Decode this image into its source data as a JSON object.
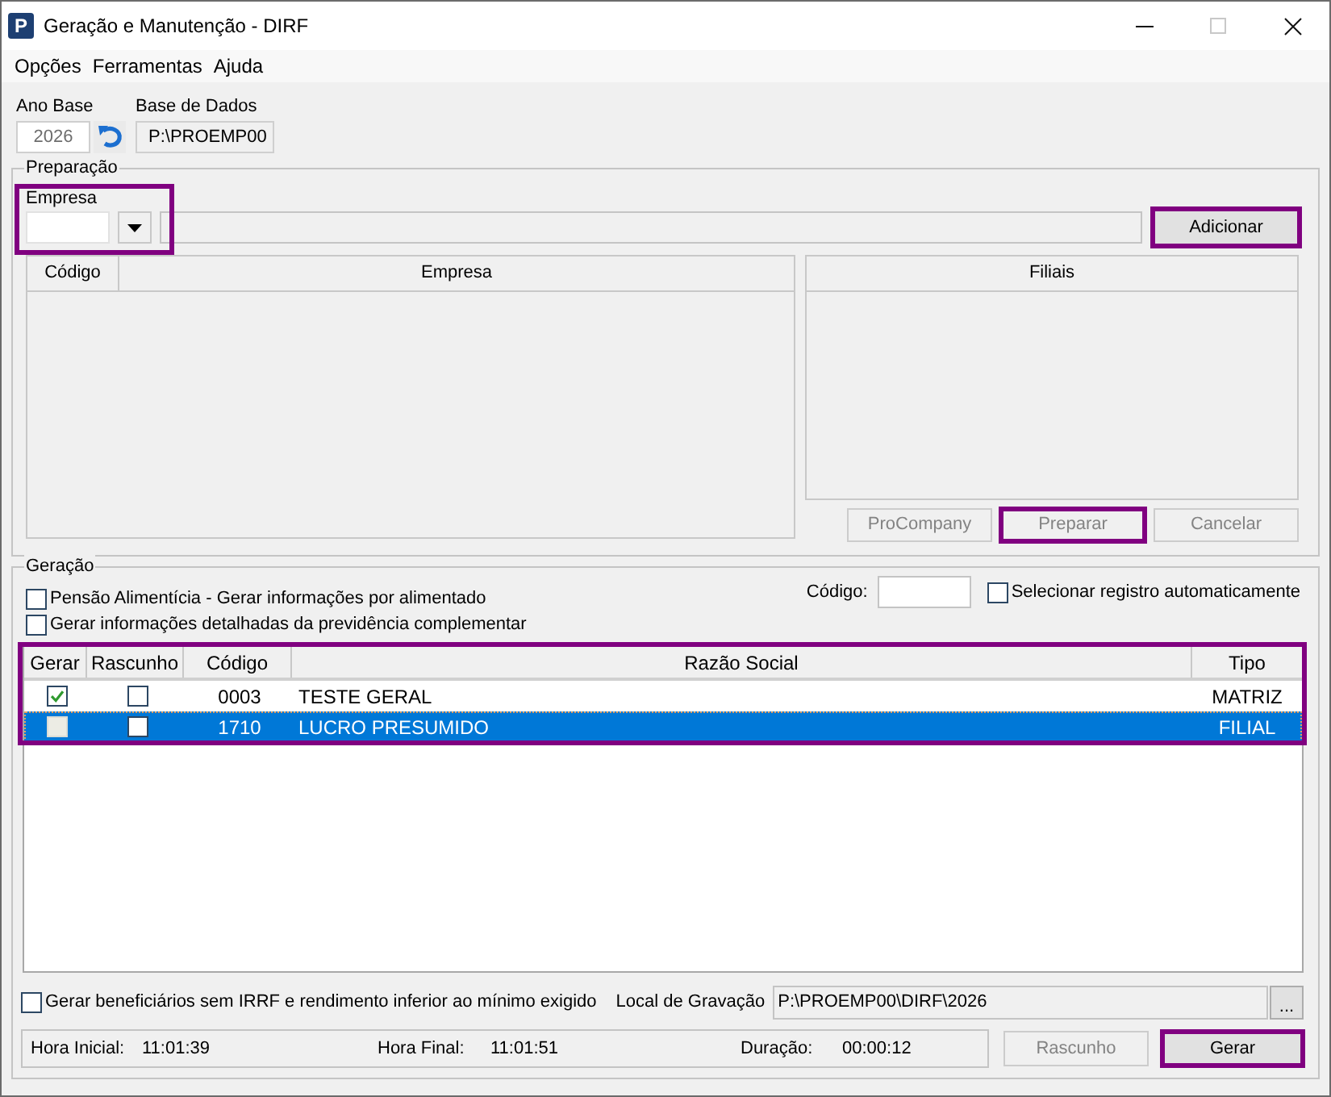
{
  "window": {
    "icon_letter": "P",
    "title": "Geração e Manutenção - DIRF",
    "controls": [
      {
        "kind": "minimize",
        "disabled": false
      },
      {
        "kind": "maximize",
        "disabled": true
      },
      {
        "kind": "close",
        "disabled": false
      }
    ]
  },
  "menu": [
    {
      "label": "Opções"
    },
    {
      "label": "Ferramentas"
    },
    {
      "label": "Ajuda"
    }
  ],
  "ano_base": {
    "label": "Ano Base",
    "value": "2026",
    "disabled": true
  },
  "base_de_dados": {
    "label": "Base de Dados",
    "value": "P:\\PROEMP00"
  },
  "preparacao": {
    "title": "Preparação",
    "empresa": {
      "label": "Empresa",
      "highlighted": true
    },
    "add_button": {
      "label": "Adicionar",
      "disabled": false,
      "highlighted": true
    },
    "empresas_table": {
      "columns": [
        "Código",
        "Empresa"
      ]
    },
    "filiais_table": {
      "columns": [
        "Filiais"
      ]
    },
    "buttons": [
      {
        "label": "ProCompany",
        "disabled": true,
        "highlighted": false
      },
      {
        "label": "Preparar",
        "disabled": true,
        "highlighted": true
      },
      {
        "label": "Cancelar",
        "disabled": true,
        "highlighted": false
      }
    ]
  },
  "geracao": {
    "title": "Geração",
    "options": [
      {
        "label": "Pensão Alimentícia - Gerar informações por alimentado",
        "checked": false
      },
      {
        "label": "Gerar informações detalhadas da previdência complementar",
        "checked": false
      }
    ],
    "codigo": {
      "label": "Código:"
    },
    "auto_select": {
      "label": "Selecionar registro automaticamente",
      "checked": false
    },
    "table": {
      "highlighted": true,
      "columns": [
        "Gerar",
        "Rascunho",
        "Código",
        "Razão Social",
        "Tipo"
      ],
      "rows": [
        {
          "gerar_checked": true,
          "gerar_disabled": false,
          "rascunho_checked": false,
          "codigo": "0003",
          "razao_social": "TESTE GERAL",
          "tipo": "MATRIZ",
          "selected": false
        },
        {
          "gerar_checked": false,
          "gerar_disabled": true,
          "rascunho_checked": false,
          "codigo": "1710",
          "razao_social": "LUCRO PRESUMIDO",
          "tipo": "FILIAL",
          "selected": true
        }
      ]
    },
    "beneficiarios_option": {
      "label": "Gerar beneficiários sem IRRF e rendimento inferior ao mínimo exigido",
      "checked": false
    },
    "local_gravacao": {
      "label": "Local de Gravação",
      "value": "P:\\PROEMP00\\DIRF\\2026",
      "browse_label": "..."
    },
    "status": [
      {
        "label": "Hora Inicial:",
        "value": "11:01:39"
      },
      {
        "label": "Hora Final:",
        "value": "11:01:51"
      },
      {
        "label": "Duração:",
        "value": "00:00:12"
      }
    ],
    "buttons": [
      {
        "label": "Rascunho",
        "disabled": true,
        "highlighted": false
      },
      {
        "label": "Gerar",
        "disabled": false,
        "highlighted": true
      }
    ]
  }
}
